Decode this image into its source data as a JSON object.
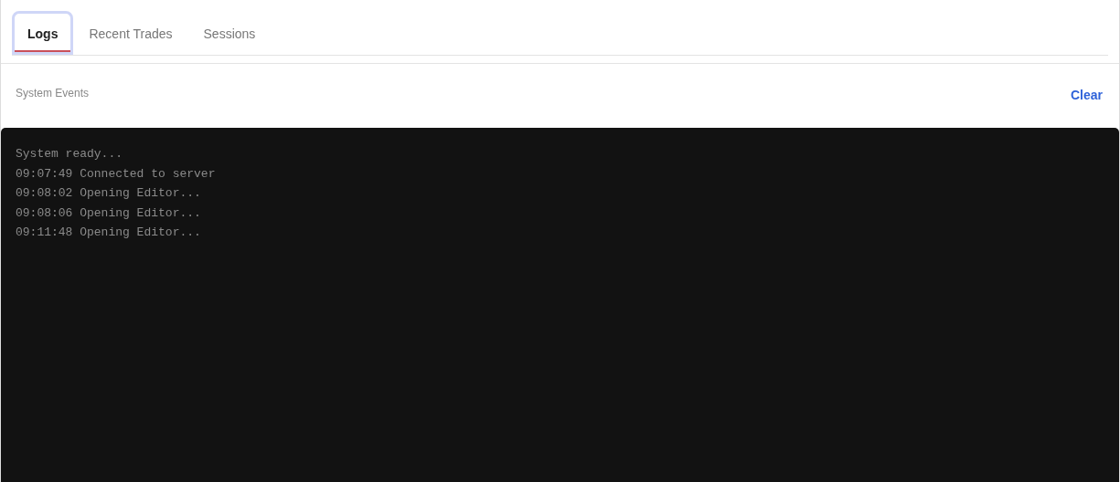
{
  "tabs": [
    {
      "label": "Logs",
      "selected": true
    },
    {
      "label": "Recent Trades",
      "selected": false
    },
    {
      "label": "Sessions",
      "selected": false
    }
  ],
  "panel": {
    "title": "System Events",
    "action": "Clear"
  },
  "log": {
    "lines": [
      "System ready...",
      "09:07:49 Connected to server",
      "09:08:02 Opening Editor...",
      "09:08:06 Opening Editor...",
      "09:11:48 Opening Editor..."
    ]
  }
}
